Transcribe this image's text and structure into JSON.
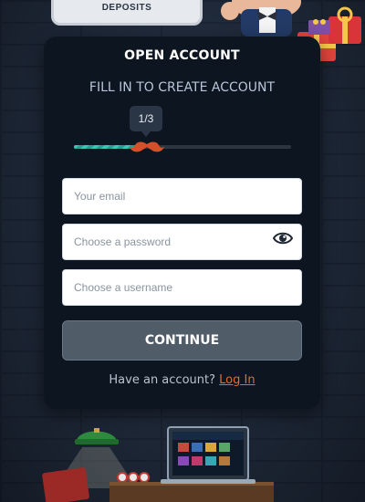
{
  "top_card": {
    "label": "DEPOSITS"
  },
  "form": {
    "title": "OPEN ACCOUNT",
    "subtitle": "FILL IN TO CREATE ACCOUNT",
    "step": "1/3",
    "progress_fraction": 0.31,
    "email_placeholder": "Your email",
    "password_placeholder": "Choose a password",
    "username_placeholder": "Choose a username",
    "continue_label": "CONTINUE",
    "have_account_text": "Have an account? ",
    "login_label": "Log In"
  },
  "colors": {
    "accent": "#e86a2a",
    "progress": "#3cc7b5",
    "panel": "#0c1520",
    "button": "#515c69"
  },
  "icons": [
    "eye-icon",
    "mustache-icon",
    "mascot-icon",
    "gift-icon",
    "lamp-icon",
    "laptop-icon"
  ]
}
